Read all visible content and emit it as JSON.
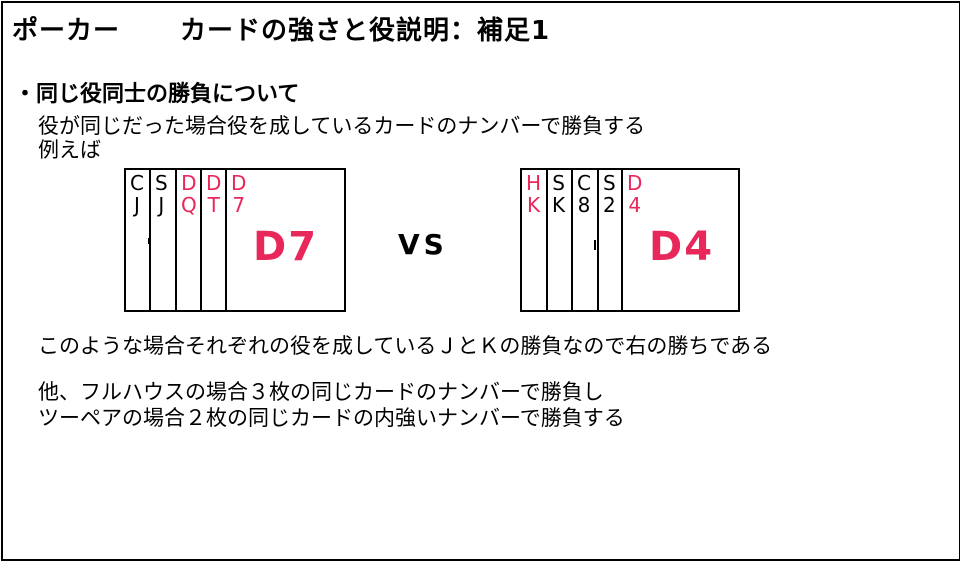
{
  "title": {
    "main": "ポーカー",
    "sub": "カードの強さと役説明：補足1"
  },
  "heading": "・同じ役同士の勝負について",
  "lines": {
    "l1": "役が同じだった場合役を成しているカードのナンバーで勝負する",
    "l2": "例えば",
    "l3": "このような場合それぞれの役を成しているＪとＫの勝負なので右の勝ちである",
    "l4": "他、フルハウスの場合３枚の同じカードのナンバーで勝負し",
    "l5": "ツーペアの場合２枚の同じカードの内強いナンバーで勝負する"
  },
  "vs": "VS",
  "left_hand": {
    "cards": [
      {
        "suit": "C",
        "rank": "J",
        "color": "#000000"
      },
      {
        "suit": "S",
        "rank": "J",
        "color": "#000000"
      },
      {
        "suit": "D",
        "rank": "Q",
        "color": "#e8285a"
      },
      {
        "suit": "D",
        "rank": "T",
        "color": "#e8285a"
      },
      {
        "suit": "D",
        "rank": "7",
        "color": "#e8285a"
      }
    ],
    "face_label": "D7"
  },
  "right_hand": {
    "cards": [
      {
        "suit": "H",
        "rank": "K",
        "color": "#e8285a"
      },
      {
        "suit": "S",
        "rank": "K",
        "color": "#000000"
      },
      {
        "suit": "C",
        "rank": "8",
        "color": "#000000"
      },
      {
        "suit": "S",
        "rank": "2",
        "color": "#000000"
      },
      {
        "suit": "D",
        "rank": "4",
        "color": "#e8285a"
      }
    ],
    "face_label": "D4"
  }
}
